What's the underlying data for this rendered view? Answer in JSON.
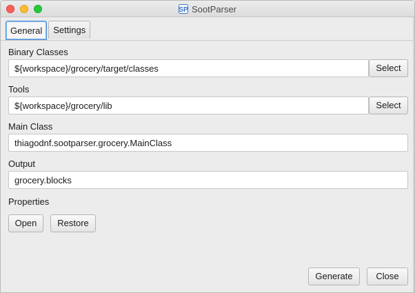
{
  "window": {
    "title": "SootParser",
    "app_icon": "sootparser-logo-icon"
  },
  "tabs": [
    {
      "label": "General",
      "active": true
    },
    {
      "label": "Settings",
      "active": false
    }
  ],
  "form": {
    "binary_classes": {
      "label": "Binary Classes",
      "value": "${workspace}/grocery/target/classes",
      "button": "Select"
    },
    "tools": {
      "label": "Tools",
      "value": "${workspace}/grocery/lib",
      "button": "Select"
    },
    "main_class": {
      "label": "Main Class",
      "value": "thiagodnf.sootparser.grocery.MainClass"
    },
    "output": {
      "label": "Output",
      "value": "grocery.blocks"
    },
    "properties": {
      "label": "Properties",
      "open_button": "Open",
      "restore_button": "Restore"
    }
  },
  "footer": {
    "generate_button": "Generate",
    "close_button": "Close"
  },
  "colors": {
    "window_bg": "#ececec",
    "close": "#fe5f57",
    "minimize": "#febc2e",
    "maximize": "#28c840",
    "active_tab_border": "#4d90d8",
    "app_icon": "#3b78c4"
  }
}
